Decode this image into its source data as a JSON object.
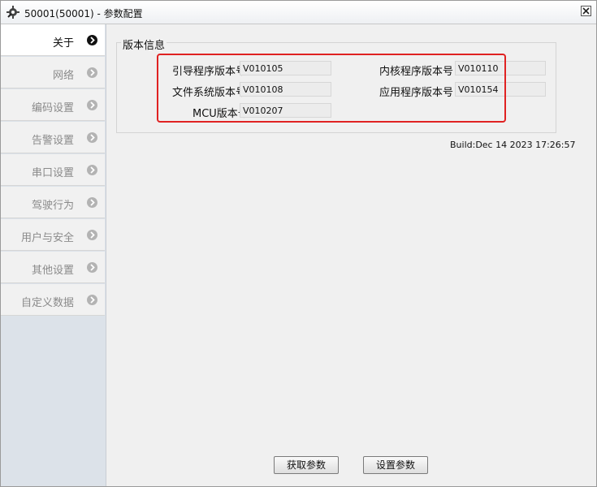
{
  "window": {
    "title": "50001(50001) - 参数配置",
    "app_icon": "gear-wrench-icon",
    "close_icon": "close-icon"
  },
  "sidebar": {
    "items": [
      {
        "label": "关于",
        "active": true
      },
      {
        "label": "网络",
        "active": false
      },
      {
        "label": "编码设置",
        "active": false
      },
      {
        "label": "告警设置",
        "active": false
      },
      {
        "label": "串口设置",
        "active": false
      },
      {
        "label": "驾驶行为",
        "active": false
      },
      {
        "label": "用户与安全",
        "active": false
      },
      {
        "label": "其他设置",
        "active": false
      },
      {
        "label": "自定义数据",
        "active": false
      }
    ]
  },
  "version_info": {
    "group_title": "版本信息",
    "bootloader": {
      "label": "引导程序版本号",
      "value": "V010105"
    },
    "kernel": {
      "label": "内核程序版本号",
      "value": "V010110"
    },
    "filesystem": {
      "label": "文件系统版本号",
      "value": "V010108"
    },
    "application": {
      "label": "应用程序版本号",
      "value": "V010154"
    },
    "mcu": {
      "label": "MCU版本号",
      "value": "V010207"
    },
    "build": "Build:Dec 14 2023 17:26:57"
  },
  "buttons": {
    "get_params": "获取参数",
    "set_params": "设置参数"
  },
  "colors": {
    "highlight": "#e02222",
    "sidebar_bg": "#dce2e9",
    "panel_bg": "#f0f0f0"
  }
}
